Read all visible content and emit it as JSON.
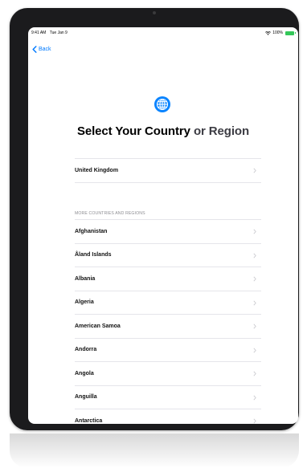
{
  "status_bar": {
    "time": "9:41 AM",
    "date": "Tue Jan 9",
    "battery": "100%"
  },
  "nav": {
    "back_label": "Back"
  },
  "header": {
    "title_main": "Select Your Country",
    "title_suffix": "or Region"
  },
  "primary_list": [
    "United Kingdom"
  ],
  "section_label": "MORE COUNTRIES AND REGIONS",
  "countries": [
    "Afghanistan",
    "Åland Islands",
    "Albania",
    "Algeria",
    "American Samoa",
    "Andorra",
    "Angola",
    "Anguilla",
    "Antarctica"
  ],
  "colors": {
    "accent": "#007aff",
    "battery": "#34c759",
    "bezel": "#1b1b1d"
  }
}
